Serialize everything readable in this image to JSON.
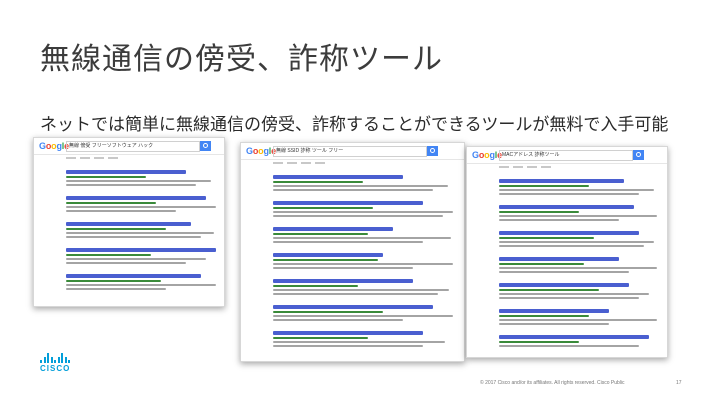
{
  "slide": {
    "title": "無線通信の傍受、詐称ツール",
    "subtitle": "ネットでは簡単に無線通信の傍受、詐称することができるツールが無料で入手可能"
  },
  "screenshots": [
    {
      "logo": "Google",
      "query": "無線 傍受 フリーソフトウェア ハック"
    },
    {
      "logo": "Google",
      "query": "無線 SSID 詐称 ツール フリー"
    },
    {
      "logo": "Google",
      "query": "MACアドレス 詐称ツール"
    }
  ],
  "footer": {
    "copyright": "© 2017  Cisco and/or its affiliates. All rights reserved.   Cisco Public",
    "page": "17"
  },
  "brand": {
    "name": "CISCO",
    "color": "#049fd9"
  }
}
